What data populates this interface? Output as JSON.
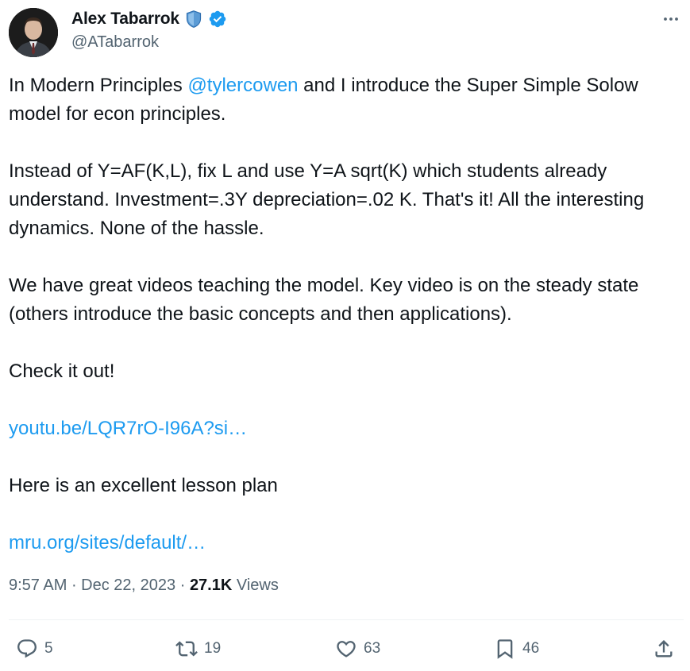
{
  "author": {
    "name": "Alex Tabarrok",
    "handle": "@ATabarrok",
    "badges": [
      "shield-icon",
      "verified-icon"
    ]
  },
  "tweet": {
    "p1_before": "In Modern Principles ",
    "p1_mention": "@tylercowen",
    "p1_after": " and I introduce the Super Simple Solow model for econ principles.",
    "p2": "Instead of Y=AF(K,L), fix L and use Y=A sqrt(K) which students already understand. Investment=.3Y depreciation=.02 K. That's it! All the interesting dynamics. None of the hassle.",
    "p3": "We have great videos teaching the model. Key video is on the steady state (others introduce the basic concepts and then applications).",
    "p4": "Check it out!",
    "link1": "youtu.be/LQR7rO-I96A?si…",
    "p5": "Here is an excellent lesson plan",
    "link2": "mru.org/sites/default/…"
  },
  "meta": {
    "time": "9:57 AM",
    "separator": " · ",
    "date": "Dec 22, 2023",
    "views_count": "27.1K",
    "views_label": " Views"
  },
  "actions": {
    "replies": "5",
    "reposts": "19",
    "likes": "63",
    "bookmarks": "46"
  },
  "colors": {
    "link": "#1d9bf0",
    "secondary_text": "#536471",
    "verified": "#1d9bf0"
  }
}
